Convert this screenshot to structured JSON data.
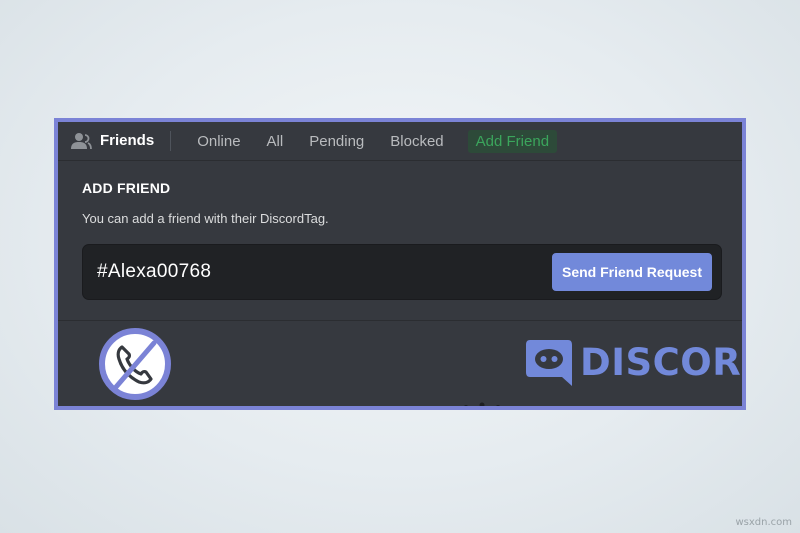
{
  "header": {
    "friends_label": "Friends",
    "tabs": [
      {
        "label": "Online"
      },
      {
        "label": "All"
      },
      {
        "label": "Pending"
      },
      {
        "label": "Blocked"
      },
      {
        "label": "Add Friend",
        "active": true
      }
    ]
  },
  "add_friend": {
    "heading": "ADD FRIEND",
    "description": "You can add a friend with their DiscordTag.",
    "input_value": "#Alexa00768",
    "send_button": "Send Friend Request"
  },
  "logo": {
    "text": "DISCORD"
  },
  "watermark": "wsxdn.com",
  "icons": [
    "friends-icon",
    "no-call-icon",
    "discord-logo-icon"
  ],
  "colors": {
    "frame_border": "#7b83d6",
    "panel_bg": "#36393f",
    "input_bg": "#202225",
    "blurple": "#7289da",
    "active_tab_green": "#3ba55c",
    "active_tab_bg": "#2d4a39"
  }
}
